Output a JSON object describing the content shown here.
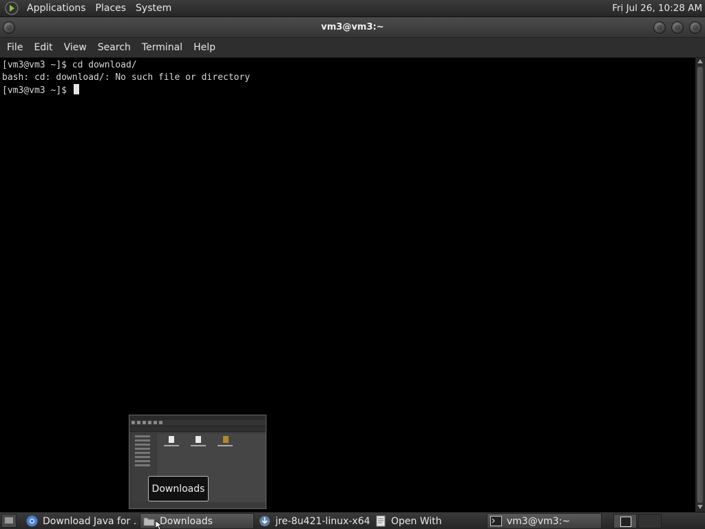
{
  "top_panel": {
    "menus": [
      "Applications",
      "Places",
      "System"
    ],
    "clock": "Fri Jul 26, 10:28 AM"
  },
  "window": {
    "title": "vm3@vm3:~"
  },
  "menubar": {
    "items": [
      "File",
      "Edit",
      "View",
      "Search",
      "Terminal",
      "Help"
    ]
  },
  "terminal": {
    "lines": [
      "[vm3@vm3 ~]$ cd download/",
      "bash: cd: download/: No such file or directory",
      "[vm3@vm3 ~]$ "
    ]
  },
  "tooltip": {
    "text": "Downloads"
  },
  "taskbar": {
    "tasks": [
      {
        "label": "Download Java for ...",
        "icon": "chrome-icon",
        "active": false
      },
      {
        "label": "Downloads",
        "icon": "folder-icon",
        "active": true
      },
      {
        "label": "jre-8u421-linux-x64...",
        "icon": "download-icon",
        "active": false
      },
      {
        "label": "Open With",
        "icon": "document-icon",
        "active": false
      },
      {
        "label": "vm3@vm3:~",
        "icon": "terminal-icon",
        "active": true
      }
    ]
  },
  "colors": {
    "terminal_bg": "#000000",
    "terminal_fg": "#d8d8d8",
    "panel_bg": "#2e2e2e"
  }
}
